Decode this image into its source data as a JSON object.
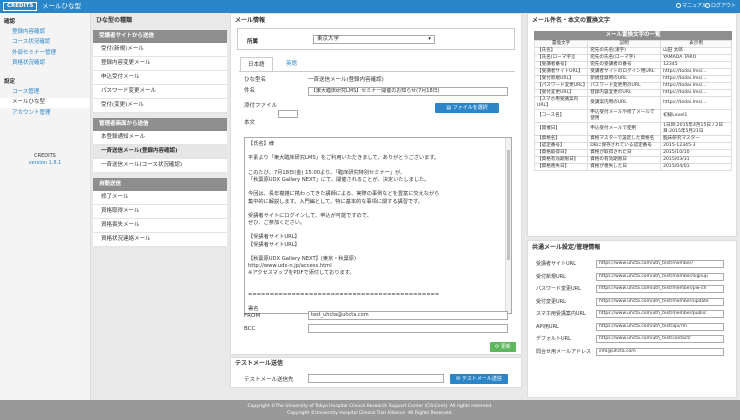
{
  "topbar": {
    "brand": "CREDITS",
    "title": "メールひな型",
    "manual": "マニュアル",
    "logout": "ログアウト"
  },
  "nav": {
    "sec1": "確認",
    "sec1_items": [
      "登録内容確認",
      "コース状況確認",
      "外部セミナー管理",
      "資格状況確認"
    ],
    "sec2": "設定",
    "sec2_items": [
      "コース管理",
      "メールひな型",
      "アカウント管理"
    ],
    "footer_name": "CREDITS",
    "footer_version": "version 1.8.1"
  },
  "types": {
    "heading": "ひな型の種類",
    "groups": [
      {
        "label": "受講者サイトから送信",
        "items": [
          "受付(新規)メール",
          "登録内容変更メール",
          "申込受付メール",
          "パスワード変更メール",
          "受付(変更)メール"
        ]
      },
      {
        "label": "管理者画面から送信",
        "items": [
          "本登録通知メール",
          "一斉送信メール(登録内容確認)",
          "一斉送信メール(コース状況確認)"
        ]
      },
      {
        "label": "自動送信",
        "items": [
          "修了メール",
          "資格取得メール",
          "資格喪失メール",
          "資格状況連絡メール"
        ]
      }
    ]
  },
  "mail": {
    "heading": "メール情報",
    "dept_label": "所属",
    "dept_value": "東京大学",
    "tab_ja": "日本語",
    "tab_en": "英語",
    "template_name_label": "ひな型名",
    "template_name": "一斉送信メール(登録内容確認)",
    "subject_label": "件名",
    "subject": "【東大臨床研究LMS】セミナー開催のお知らせ(7月18日)",
    "attach_label": "添付ファイル",
    "attach_btn": "ファイルを選択",
    "body_label": "本文",
    "body_lines": [
      "【氏名】様",
      "",
      "平素より「東大臨床研究LMS」をご利用いただきまして、ありがとうございます。",
      "",
      "このたび、7月18日(金) 15:00より、「臨床研究特別セミナー」が、",
      "「秋葉原UDX Gallery NEXT」にて、開催されることが、決定いたしました。",
      "",
      "今回は、長年複雑に携わってきた講師による、実際の事例などを豊富に交えながら",
      "集中的に解説します。入門編として、特に基本的な事項に関する講習です。",
      "",
      "受講者サイトにログインして、申込が可能ですので、",
      "ぜひ、ご参加ください。",
      "",
      "【受講者サイトURL】",
      "【受講者サイトURL】",
      "",
      "【秋葉原UDX Gallery NEXT】(東京・秋葉原)",
      "http://www.udx-n.jp/access.html",
      "※アクセスマップをPDFで添付しております。",
      "",
      "",
      "============================================",
      "",
      "署名"
    ],
    "from_label": "FROM",
    "from_value": "test_uhcta@uhcta.com",
    "bcc_label": "BCC",
    "bcc_value": "",
    "update_btn": "更新"
  },
  "test": {
    "heading": "テストメール送信",
    "label": "テストメール送信先",
    "value": "",
    "button": "テストメール送信"
  },
  "replace": {
    "heading": "メール件名・本文の置換文字",
    "table_title": "メール置換文字の一覧",
    "columns": [
      "置換文字",
      "説明",
      "表示例"
    ],
    "rows": [
      [
        "【氏名】",
        "宛先の氏名(漢字)",
        "山田 太郎"
      ],
      [
        "【氏名(ローマ字)】",
        "宛先の氏名(ローマ字)",
        "YAMADA TARO"
      ],
      [
        "【受講者番号】",
        "宛先の受講者の番号",
        "12345"
      ],
      [
        "【受講者サイトURL】",
        "受講者サイトのログイン用URL",
        "https://todai.lms/..."
      ],
      [
        "【受付新規URL】",
        "新規登録用のURL",
        "https://todai.lms/..."
      ],
      [
        "【パスワード変更URL】",
        "パスワード変更用のURL",
        "https://todai.lms/..."
      ],
      [
        "【受付変更URL】",
        "登録内容変更のURL",
        "https://todai.lms/..."
      ],
      [
        "【スマホ用受講案内URL】",
        "受講案内用のURL",
        "https://todai.lms/..."
      ],
      [
        "【コース名】",
        "申込受付メールや修了メールで使用",
        "初級Level1"
      ],
      [
        "【開催日】",
        "申込受付メールで使用",
        "1日目:2015年4月15日 / 2日目:2015年5月21日"
      ],
      [
        "【資格名】",
        "資格マスターで設定した資格名",
        "臨床研究マスター"
      ],
      [
        "【認定番号】",
        "DBに保存されている認定番号",
        "2015-12345-3"
      ],
      [
        "【資格取得日】",
        "資格が取得された日",
        "2015/10/10"
      ],
      [
        "【資格有効期限日】",
        "資格の有効期限日",
        "2015/03/31"
      ],
      [
        "【資格喪失日】",
        "資格が喪失した日",
        "2015/04/01"
      ]
    ]
  },
  "config": {
    "heading": "共通メール設定/管理情報",
    "rows": [
      [
        "受講者サイトURL",
        "https://www.uhcta.com/uth_test/member/"
      ],
      [
        "受付新規URL",
        "https://www.uhcta.com/uth_test/member/signup"
      ],
      [
        "パスワード変更URL",
        "https://www.uhcta.com/uth_test/member/pw-ch"
      ],
      [
        "受付変更URL",
        "https://www.uhcta.com/uth_test/member/update"
      ],
      [
        "スマホ用受講案内URL",
        "https://www.uhcta.com/uth_test/member/public"
      ],
      [
        "API用URL",
        "https://www.uhcta.com/uth_test/api/rm"
      ],
      [
        "デフォルトURL",
        "https://www.uhcta.com/uth_test/contact/"
      ],
      [
        "問合せ用メールアドレス",
        "info@uhcta.com"
      ]
    ]
  },
  "footer": {
    "line1": "Copyright ©The University of Tokyo Hospital Clinical Research Support Center (ClinCent). All rights reserved.",
    "line2": "Copyright ©University Hospital Clinical Trial Alliance. All Rights Reserved."
  }
}
